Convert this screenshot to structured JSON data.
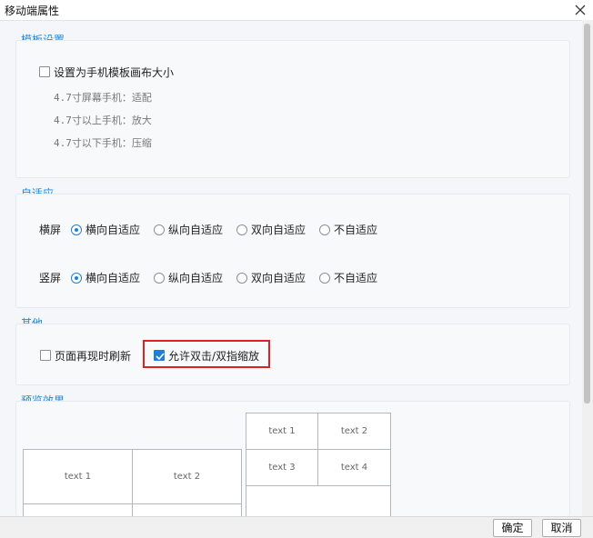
{
  "window": {
    "title": "移动端属性",
    "close_icon": "close-icon"
  },
  "template_section": {
    "title": "模板设置",
    "checkbox_label": "设置为手机模板画布大小",
    "checked": false,
    "items": [
      "4.7寸屏幕手机：适配",
      "4.7寸以上手机：放大",
      "4.7寸以下手机：压缩"
    ]
  },
  "adaptive_section": {
    "title": "自适应",
    "rows": [
      {
        "label": "横屏",
        "options": [
          "横向自适应",
          "纵向自适应",
          "双向自适应",
          "不自适应"
        ],
        "selected": "横向自适应"
      },
      {
        "label": "竖屏",
        "options": [
          "横向自适应",
          "纵向自适应",
          "双向自适应",
          "不自适应"
        ],
        "selected": "横向自适应"
      }
    ]
  },
  "other_section": {
    "title": "其他",
    "refresh": {
      "label": "页面再现时刷新",
      "checked": false
    },
    "zoom": {
      "label": "允许双击/双指缩放",
      "checked": true
    },
    "highlight_color": "#e02020"
  },
  "preview_section": {
    "title": "预览效果",
    "left_grid": [
      [
        "text 1",
        "text 2"
      ],
      [
        "",
        ""
      ]
    ],
    "right_grid": [
      [
        "text 1",
        "text 2"
      ],
      [
        "text 3",
        "text 4"
      ],
      [
        ""
      ]
    ]
  },
  "footer": {
    "ok": "确定",
    "cancel": "取消"
  },
  "colors": {
    "accent": "#1e8be0",
    "checkbox_checked": "#1e7fd8"
  }
}
